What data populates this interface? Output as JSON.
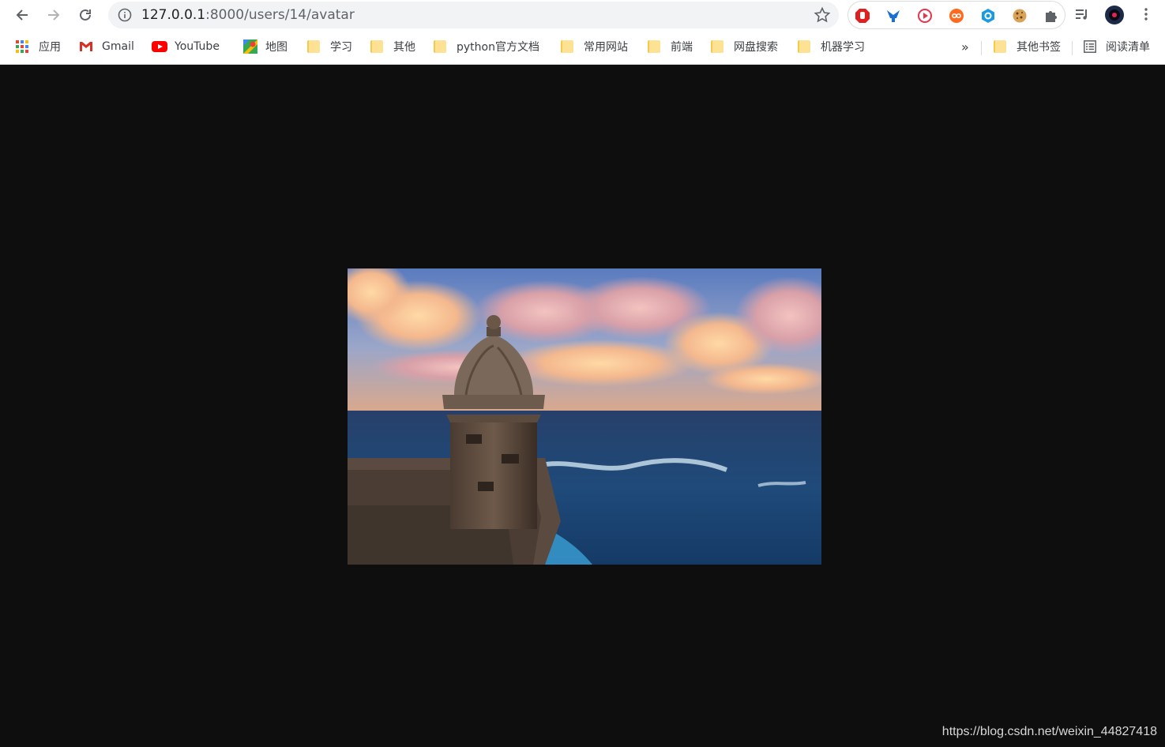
{
  "browser": {
    "url_host": "127.0.0.1",
    "url_rest": ":8000/users/14/avatar",
    "icons": {
      "back": "arrow-left-icon",
      "forward": "arrow-right-icon",
      "reload": "reload-icon",
      "info": "info-icon",
      "star": "star-icon",
      "menu": "kebab-menu-icon"
    }
  },
  "extensions": [
    "adblock-icon",
    "vpn-icon",
    "record-icon",
    "infinity-icon",
    "hex-icon",
    "cookie-icon",
    "puzzle-icon",
    "media-icon",
    "profile-avatar"
  ],
  "bookmarks": [
    {
      "label": "应用",
      "icon": "apps-grid-icon"
    },
    {
      "label": "Gmail",
      "icon": "gmail-icon"
    },
    {
      "label": "YouTube",
      "icon": "youtube-icon"
    },
    {
      "label": "地图",
      "icon": "maps-icon"
    },
    {
      "label": "学习",
      "icon": "folder-icon"
    },
    {
      "label": "其他",
      "icon": "folder-icon"
    },
    {
      "label": "python官方文档",
      "icon": "folder-icon"
    },
    {
      "label": "常用网站",
      "icon": "folder-icon"
    },
    {
      "label": "前端",
      "icon": "folder-icon"
    },
    {
      "label": "网盘搜索",
      "icon": "folder-icon"
    },
    {
      "label": "机器学习",
      "icon": "folder-icon"
    }
  ],
  "overflow_label": "»",
  "other_bookmarks": "其他书签",
  "reading_list": "阅读清单",
  "watermark": "https://blog.csdn.net/weixin_44827418",
  "colors": {
    "page_bg": "#0e0e0e",
    "toolbar_bg": "#ffffff",
    "omnibox_bg": "#f1f3f4",
    "folder": "#fde293"
  }
}
